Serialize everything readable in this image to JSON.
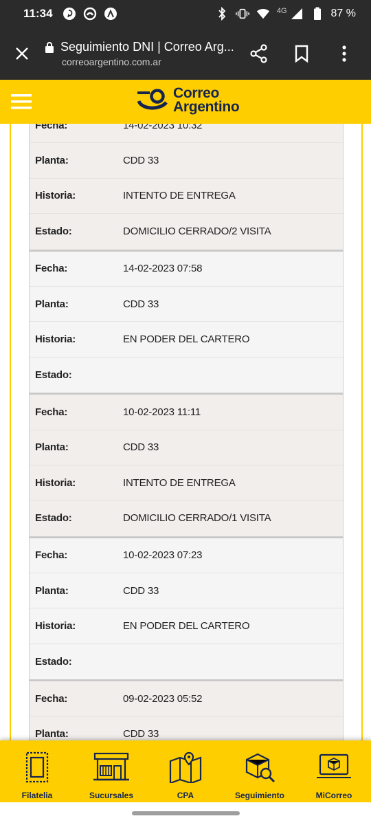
{
  "status_bar": {
    "time": "11:34",
    "network": "4G",
    "battery": "87 %"
  },
  "browser": {
    "page_title": "Seguimiento DNI | Correo Arg...",
    "url": "correoargentino.com.ar"
  },
  "site": {
    "logo_line1": "Correo",
    "logo_line2": "Argentino",
    "brand_color": "#ffce00",
    "brand_navy": "#15254f"
  },
  "events": [
    {
      "fecha_label": "Fecha:",
      "fecha": "14-02-2023 10:32",
      "planta_label": "Planta:",
      "planta": "CDD 33",
      "historia_label": "Historia:",
      "historia": "INTENTO DE ENTREGA",
      "estado_label": "Estado:",
      "estado": "DOMICILIO CERRADO/2 VISITA"
    },
    {
      "fecha_label": "Fecha:",
      "fecha": "14-02-2023 07:58",
      "planta_label": "Planta:",
      "planta": "CDD 33",
      "historia_label": "Historia:",
      "historia": "EN PODER DEL CARTERO",
      "estado_label": "Estado:",
      "estado": ""
    },
    {
      "fecha_label": "Fecha:",
      "fecha": "10-02-2023 11:11",
      "planta_label": "Planta:",
      "planta": "CDD 33",
      "historia_label": "Historia:",
      "historia": "INTENTO DE ENTREGA",
      "estado_label": "Estado:",
      "estado": "DOMICILIO CERRADO/1 VISITA"
    },
    {
      "fecha_label": "Fecha:",
      "fecha": "10-02-2023 07:23",
      "planta_label": "Planta:",
      "planta": "CDD 33",
      "historia_label": "Historia:",
      "historia": "EN PODER DEL CARTERO",
      "estado_label": "Estado:",
      "estado": ""
    },
    {
      "fecha_label": "Fecha:",
      "fecha": "09-02-2023 05:52",
      "planta_label": "Planta:",
      "planta": "CDD 33",
      "historia_label": "Historia:",
      "historia": "",
      "estado_label": "Estado:",
      "estado": ""
    }
  ],
  "bottom_nav": [
    {
      "label": "Filatelia",
      "icon": "stamp-icon"
    },
    {
      "label": "Sucursales",
      "icon": "storefront-icon"
    },
    {
      "label": "CPA",
      "icon": "map-pin-icon"
    },
    {
      "label": "Seguimiento",
      "icon": "package-search-icon"
    },
    {
      "label": "MiCorreo",
      "icon": "laptop-package-icon"
    }
  ]
}
